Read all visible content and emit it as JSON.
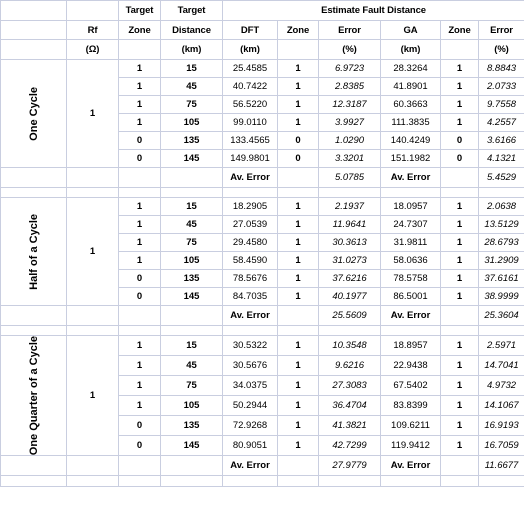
{
  "table": {
    "header": {
      "group_title": "Estimate Fault Distance",
      "col_rf": "Rf",
      "col_rf_unit": "(Ω)",
      "col_target_zone_l1": "Target",
      "col_target_zone_l2": "Zone",
      "col_target_distance_l1": "Target",
      "col_target_distance_l2": "Distance",
      "col_target_distance_unit": "(km)",
      "col_dft": "DFT",
      "col_dft_unit": "(km)",
      "col_dft_zone": "Zone",
      "col_dft_error": "Error",
      "col_dft_error_unit": "(%)",
      "col_ga": "GA",
      "col_ga_unit": "(km)",
      "col_ga_zone": "Zone",
      "col_ga_error": "Error",
      "col_ga_error_unit": "(%)"
    },
    "av_error_label": "Av. Error",
    "sections": [
      {
        "name": "One Cycle",
        "rf": "1",
        "rows": [
          {
            "target_zone": "1",
            "target_distance": "15",
            "dft": "25.4585",
            "dft_zone": "1",
            "dft_error": "6.9723",
            "ga": "28.3264",
            "ga_zone": "1",
            "ga_error": "8.8843"
          },
          {
            "target_zone": "1",
            "target_distance": "45",
            "dft": "40.7422",
            "dft_zone": "1",
            "dft_error": "2.8385",
            "ga": "41.8901",
            "ga_zone": "1",
            "ga_error": "2.0733"
          },
          {
            "target_zone": "1",
            "target_distance": "75",
            "dft": "56.5220",
            "dft_zone": "1",
            "dft_error": "12.3187",
            "ga": "60.3663",
            "ga_zone": "1",
            "ga_error": "9.7558"
          },
          {
            "target_zone": "1",
            "target_distance": "105",
            "dft": "99.0110",
            "dft_zone": "1",
            "dft_error": "3.9927",
            "ga": "111.3835",
            "ga_zone": "1",
            "ga_error": "4.2557"
          },
          {
            "target_zone": "0",
            "target_distance": "135",
            "dft": "133.4565",
            "dft_zone": "0",
            "dft_error": "1.0290",
            "ga": "140.4249",
            "ga_zone": "0",
            "ga_error": "3.6166"
          },
          {
            "target_zone": "0",
            "target_distance": "145",
            "dft": "149.9801",
            "dft_zone": "0",
            "dft_error": "3.3201",
            "ga": "151.1982",
            "ga_zone": "0",
            "ga_error": "4.1321"
          }
        ],
        "dft_av_error": "5.0785",
        "ga_av_error": "5.4529"
      },
      {
        "name": "Half of a Cycle",
        "rf": "1",
        "rows": [
          {
            "target_zone": "1",
            "target_distance": "15",
            "dft": "18.2905",
            "dft_zone": "1",
            "dft_error": "2.1937",
            "ga": "18.0957",
            "ga_zone": "1",
            "ga_error": "2.0638"
          },
          {
            "target_zone": "1",
            "target_distance": "45",
            "dft": "27.0539",
            "dft_zone": "1",
            "dft_error": "11.9641",
            "ga": "24.7307",
            "ga_zone": "1",
            "ga_error": "13.5129"
          },
          {
            "target_zone": "1",
            "target_distance": "75",
            "dft": "29.4580",
            "dft_zone": "1",
            "dft_error": "30.3613",
            "ga": "31.9811",
            "ga_zone": "1",
            "ga_error": "28.6793"
          },
          {
            "target_zone": "1",
            "target_distance": "105",
            "dft": "58.4590",
            "dft_zone": "1",
            "dft_error": "31.0273",
            "ga": "58.0636",
            "ga_zone": "1",
            "ga_error": "31.2909"
          },
          {
            "target_zone": "0",
            "target_distance": "135",
            "dft": "78.5676",
            "dft_zone": "1",
            "dft_error": "37.6216",
            "ga": "78.5758",
            "ga_zone": "1",
            "ga_error": "37.6161"
          },
          {
            "target_zone": "0",
            "target_distance": "145",
            "dft": "84.7035",
            "dft_zone": "1",
            "dft_error": "40.1977",
            "ga": "86.5001",
            "ga_zone": "1",
            "ga_error": "38.9999"
          }
        ],
        "dft_av_error": "25.5609",
        "ga_av_error": "25.3604"
      },
      {
        "name": "One Quarter of a Cycle",
        "rf": "1",
        "rows": [
          {
            "target_zone": "1",
            "target_distance": "15",
            "dft": "30.5322",
            "dft_zone": "1",
            "dft_error": "10.3548",
            "ga": "18.8957",
            "ga_zone": "1",
            "ga_error": "2.5971"
          },
          {
            "target_zone": "1",
            "target_distance": "45",
            "dft": "30.5676",
            "dft_zone": "1",
            "dft_error": "9.6216",
            "ga": "22.9438",
            "ga_zone": "1",
            "ga_error": "14.7041"
          },
          {
            "target_zone": "1",
            "target_distance": "75",
            "dft": "34.0375",
            "dft_zone": "1",
            "dft_error": "27.3083",
            "ga": "67.5402",
            "ga_zone": "1",
            "ga_error": "4.9732"
          },
          {
            "target_zone": "1",
            "target_distance": "105",
            "dft": "50.2944",
            "dft_zone": "1",
            "dft_error": "36.4704",
            "ga": "83.8399",
            "ga_zone": "1",
            "ga_error": "14.1067"
          },
          {
            "target_zone": "0",
            "target_distance": "135",
            "dft": "72.9268",
            "dft_zone": "1",
            "dft_error": "41.3821",
            "ga": "109.6211",
            "ga_zone": "1",
            "ga_error": "16.9193"
          },
          {
            "target_zone": "0",
            "target_distance": "145",
            "dft": "80.9051",
            "dft_zone": "1",
            "dft_error": "42.7299",
            "ga": "119.9412",
            "ga_zone": "1",
            "ga_error": "16.7059"
          }
        ],
        "dft_av_error": "27.9779",
        "ga_av_error": "11.6677"
      }
    ]
  }
}
